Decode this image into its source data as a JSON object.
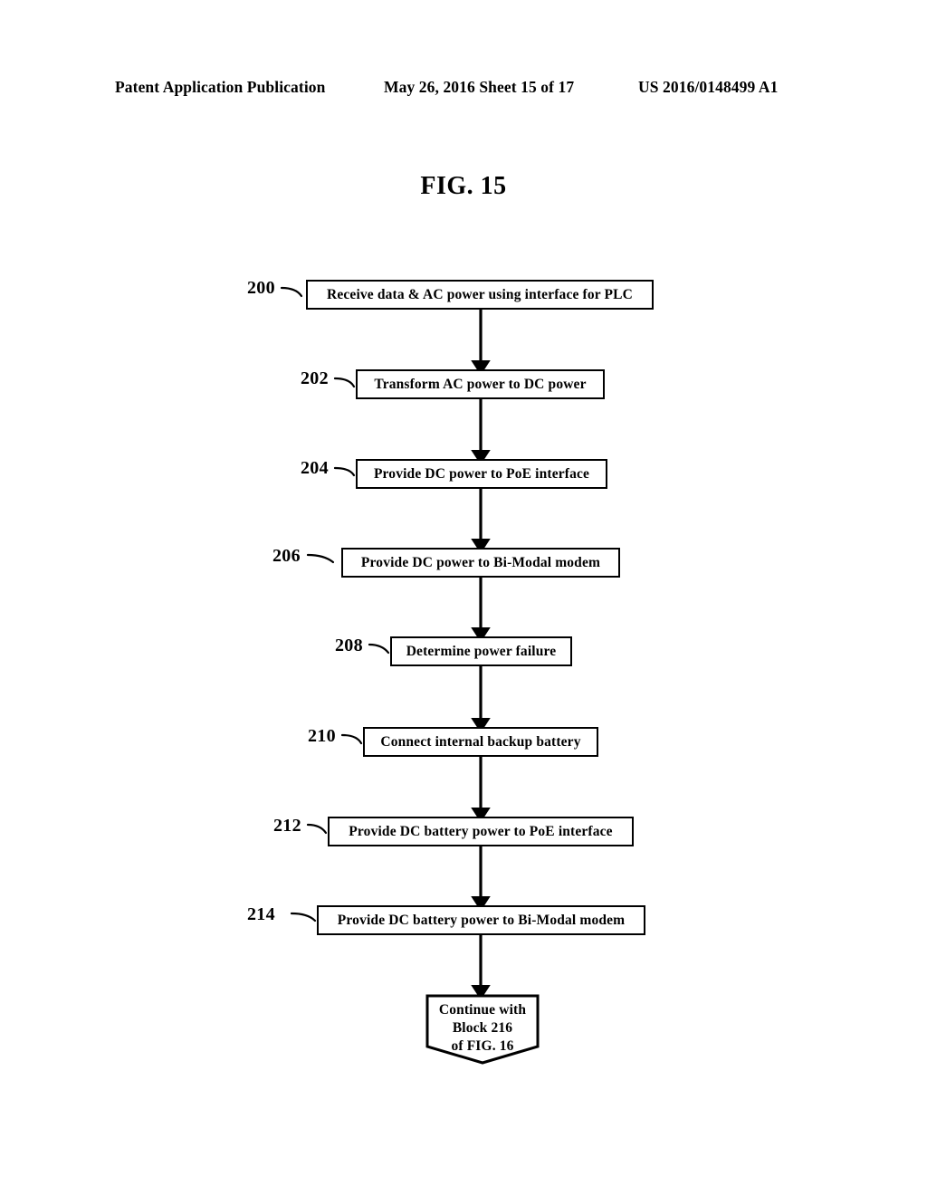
{
  "header": {
    "publication": "Patent Application Publication",
    "date_sheet": "May 26, 2016  Sheet 15 of 17",
    "patent_number": "US 2016/0148499 A1"
  },
  "figure": {
    "title": "FIG. 15"
  },
  "flowchart": {
    "nodes": [
      {
        "ref": "200",
        "label": "Receive data & AC power using interface for PLC",
        "shape": "process"
      },
      {
        "ref": "202",
        "label": "Transform AC power to DC power",
        "shape": "process"
      },
      {
        "ref": "204",
        "label": "Provide DC power to PoE interface",
        "shape": "process"
      },
      {
        "ref": "206",
        "label": "Provide DC power to Bi-Modal modem",
        "shape": "process"
      },
      {
        "ref": "208",
        "label": "Determine power failure",
        "shape": "process"
      },
      {
        "ref": "210",
        "label": "Connect internal backup battery",
        "shape": "process"
      },
      {
        "ref": "212",
        "label": "Provide DC battery power to PoE interface",
        "shape": "process"
      },
      {
        "ref": "214",
        "label": "Provide DC battery power to Bi-Modal modem",
        "shape": "process"
      }
    ],
    "terminal": {
      "line1": "Continue with",
      "line2": "Block 216",
      "line3": "of FIG. 16"
    }
  },
  "colors": {
    "ink": "#000000",
    "paper": "#ffffff"
  }
}
